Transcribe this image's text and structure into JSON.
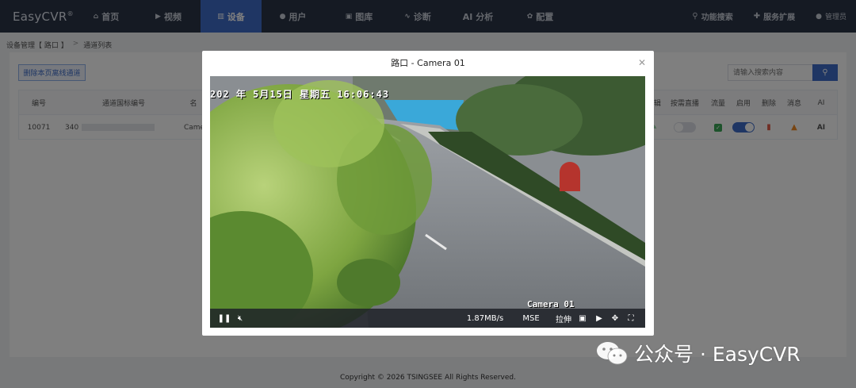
{
  "app": {
    "logo": "EasyCVR",
    "logo_mark": "®"
  },
  "nav": [
    {
      "label": "首页",
      "icon": "home-icon",
      "active": false
    },
    {
      "label": "视频",
      "icon": "play-icon",
      "active": false
    },
    {
      "label": "设备",
      "icon": "device-icon",
      "active": true
    },
    {
      "label": "用户",
      "icon": "user-icon",
      "active": false
    },
    {
      "label": "图库",
      "icon": "gallery-icon",
      "active": false
    },
    {
      "label": "诊断",
      "icon": "diagnose-icon",
      "active": false
    },
    {
      "label": "AI 分析",
      "icon": "",
      "active": false
    },
    {
      "label": "配置",
      "icon": "gear-icon",
      "active": false
    }
  ],
  "nav_right": {
    "search": "功能搜索",
    "extend": "服务扩展",
    "user": "管理员"
  },
  "breadcrumb": {
    "first": "设备管理【 路口 】",
    "sep": ">",
    "second": "通道列表"
  },
  "toolbar": {
    "delete_offline": "删除本页离线通道",
    "search_placeholder": "请输入搜索内容"
  },
  "table": {
    "headers": {
      "id": "编号",
      "gb_id": "通道国标编号",
      "name": "名",
      "edit": "编辑",
      "on_demand": "按需直播",
      "flow": "流量",
      "enable": "启用",
      "delete": "删除",
      "msg": "消息",
      "ai": "AI"
    },
    "row": {
      "id": "10071",
      "gb_prefix": "340",
      "name": "Came",
      "ai": "AI",
      "on_demand": false,
      "enabled": true
    }
  },
  "modal": {
    "title": "路口 - Camera 01",
    "osd_time": "202 年 5月15日 星期五 16:06:43",
    "osd_camera": "Camera 01",
    "controls": {
      "bitrate": "1.87MB/s",
      "decoder": "MSE",
      "stretch": "拉伸"
    }
  },
  "footer": "Copyright © 2026 TSINGSEE All Rights Reserved.",
  "watermark": {
    "text": "公众号 · EasyCVR"
  },
  "colors": {
    "nav_bg": "#2b3446",
    "accent": "#3e6cc9"
  }
}
